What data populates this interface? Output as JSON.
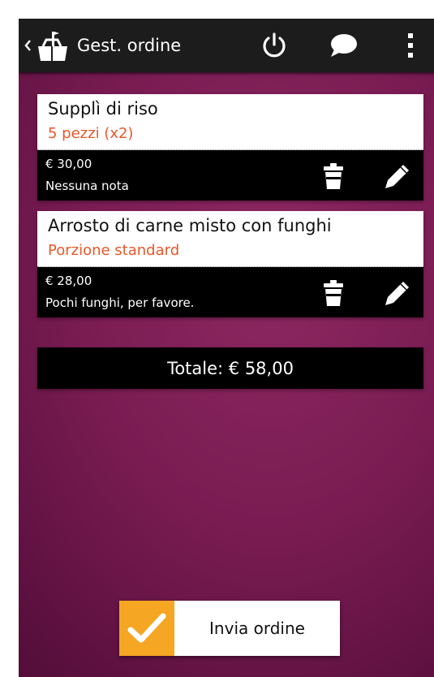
{
  "app": {
    "title": "Gest. ordine"
  },
  "actionbar": {
    "icons": [
      "back-chevron-icon",
      "app-bag-icon",
      "power-icon",
      "chat-bubble-icon",
      "overflow-menu-icon"
    ]
  },
  "order": {
    "items": [
      {
        "name": "Supplì di riso",
        "portion": "5 pezzi (x2)",
        "price": "€ 30,00",
        "note": "Nessuna nota"
      },
      {
        "name": "Arrosto di carne misto con funghi",
        "portion": "Porzione standard",
        "price": "€ 28,00",
        "note": "Pochi funghi, per favore."
      }
    ],
    "total": "Totale: € 58,00"
  },
  "actions": {
    "send_label": "Invia ordine"
  },
  "colors": {
    "background": "#7a1c53",
    "actionbar": "#1c1c1c",
    "portion_text": "#e8572a",
    "send_accent": "#f5a623"
  }
}
